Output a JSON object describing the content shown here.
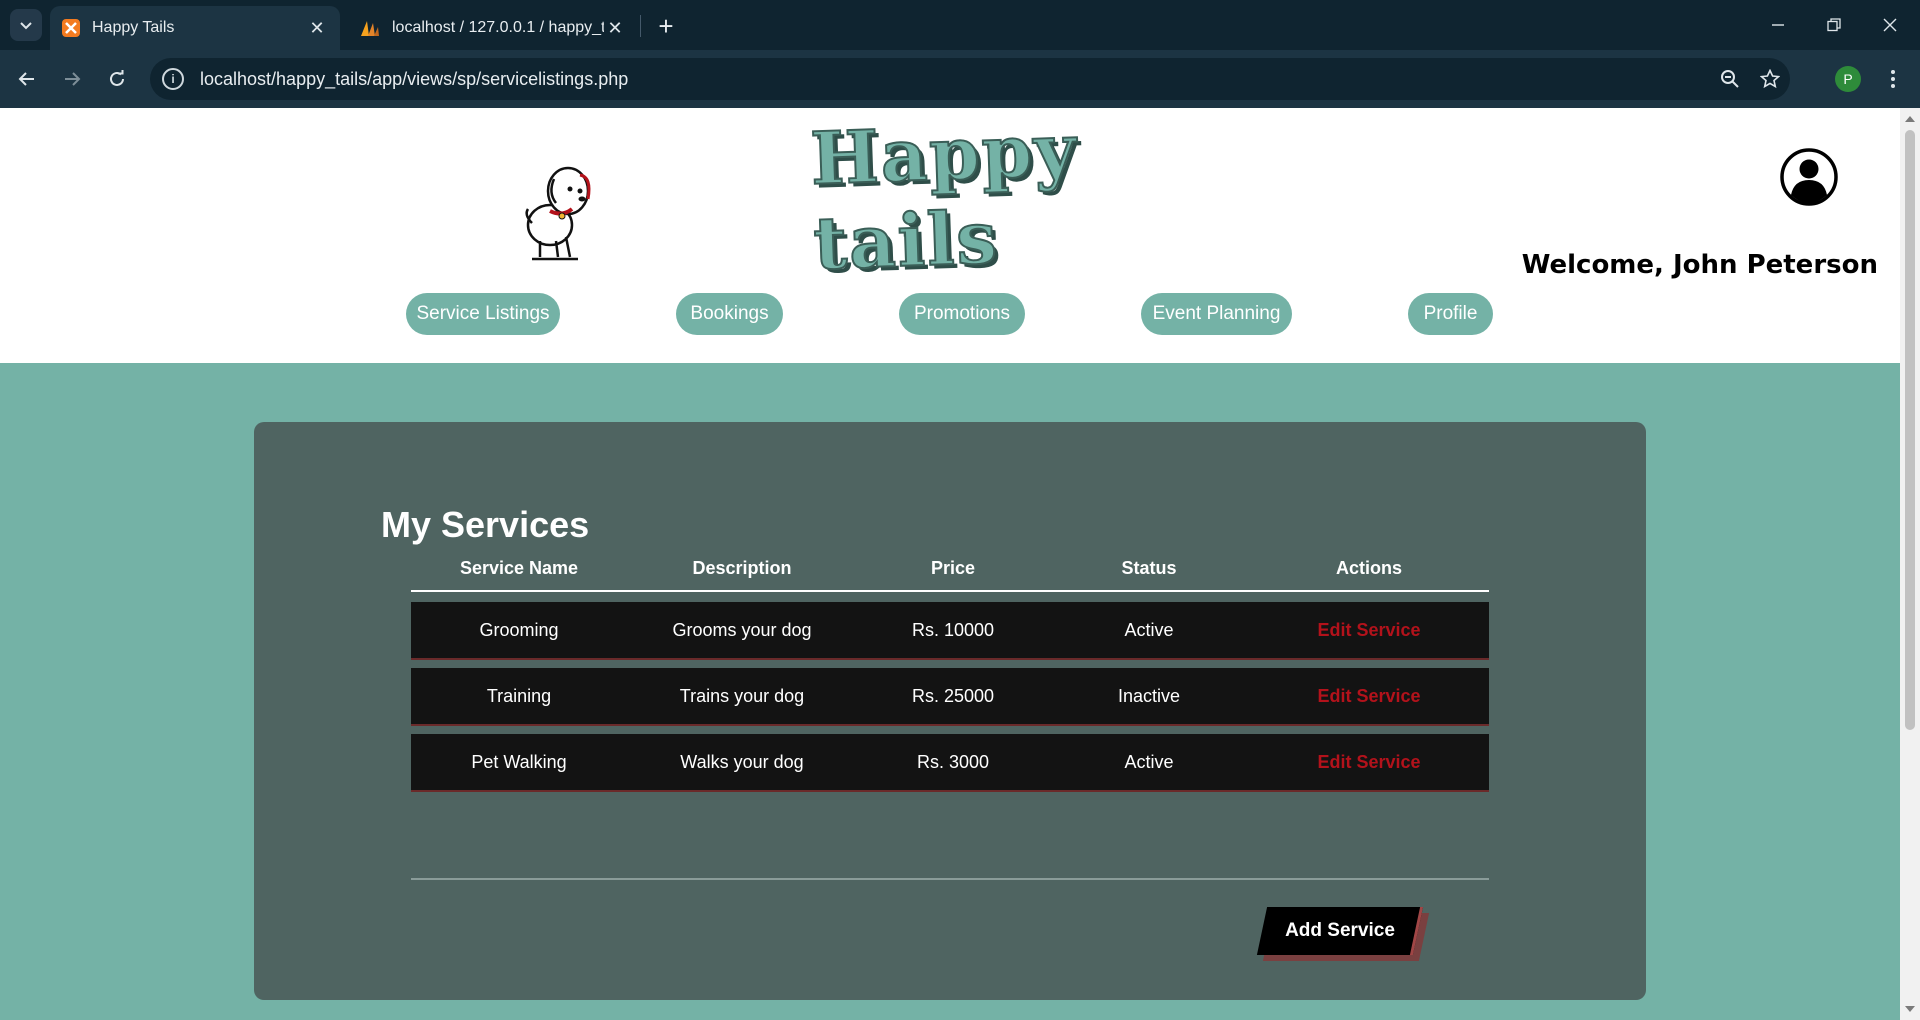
{
  "browser": {
    "tabs": [
      {
        "title": "Happy Tails",
        "icon": "xampp-icon",
        "active": true
      },
      {
        "title": "localhost / 127.0.0.1 / happy_tai",
        "icon": "phpmyadmin-icon",
        "active": false
      }
    ],
    "url": "localhost/happy_tails/app/views/sp/servicelistings.php",
    "profile_initial": "P"
  },
  "site": {
    "brand": "Happy tails",
    "welcome": "Welcome, John Peterson",
    "nav": [
      {
        "label": "Service Listings"
      },
      {
        "label": "Bookings"
      },
      {
        "label": "Promotions"
      },
      {
        "label": "Event Planning"
      },
      {
        "label": "Profile"
      }
    ]
  },
  "services": {
    "title": "My Services",
    "columns": [
      "Service Name",
      "Description",
      "Price",
      "Status",
      "Actions"
    ],
    "rows": [
      {
        "name": "Grooming",
        "description": "Grooms your dog",
        "price": "Rs. 10000",
        "status": "Active",
        "action": "Edit Service"
      },
      {
        "name": "Training",
        "description": "Trains your dog",
        "price": "Rs. 25000",
        "status": "Inactive",
        "action": "Edit Service"
      },
      {
        "name": "Pet Walking",
        "description": "Walks your dog",
        "price": "Rs. 3000",
        "status": "Active",
        "action": "Edit Service"
      }
    ],
    "add_label": "Add Service"
  },
  "colors": {
    "teal": "#74b2a6",
    "panel": "#4f6461",
    "row_bg": "#131313",
    "edit_red": "#b3121b"
  }
}
